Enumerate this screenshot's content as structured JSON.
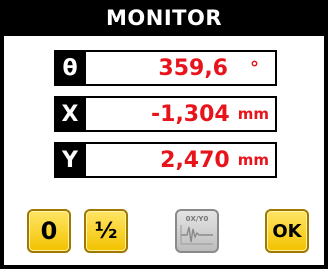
{
  "window": {
    "title": "MONITOR"
  },
  "readouts": [
    {
      "label": "θ",
      "value": "359,6",
      "unit": "°"
    },
    {
      "label": "X",
      "value": "-1,304",
      "unit": "mm"
    },
    {
      "label": "Y",
      "value": "2,470",
      "unit": "mm"
    }
  ],
  "buttons": {
    "zero": "0",
    "half": "½",
    "wave_label": "0X/Y0",
    "ok": "OK"
  },
  "colors": {
    "value": "#e8141c",
    "button": "#f2c200",
    "background": "#000000"
  }
}
